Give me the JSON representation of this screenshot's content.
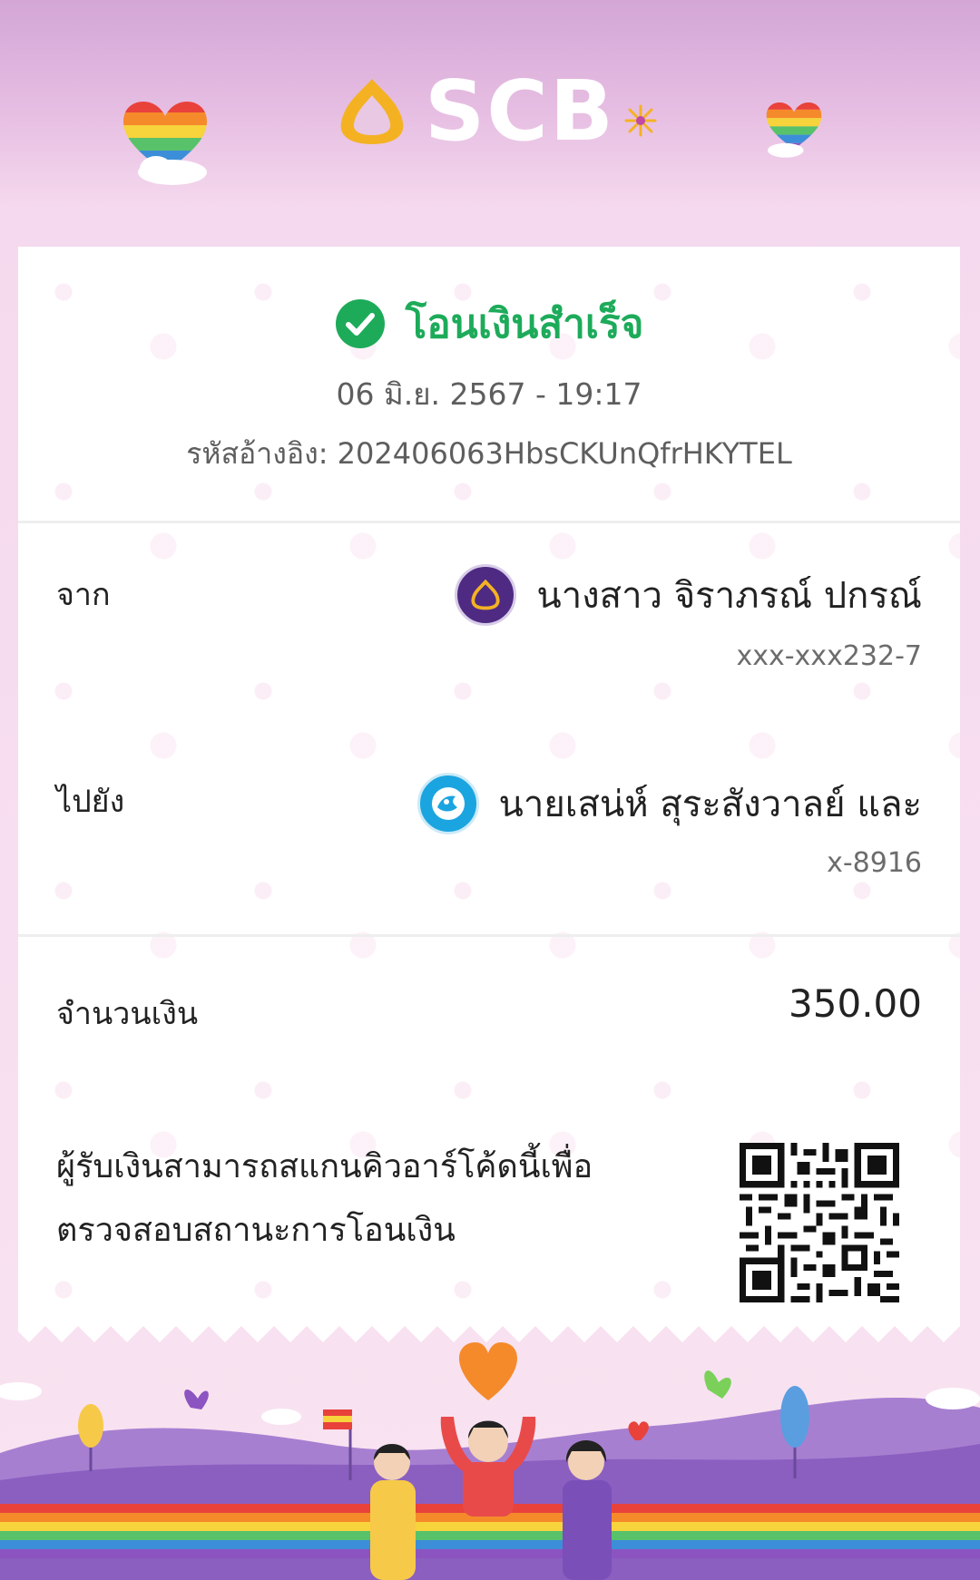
{
  "brand": {
    "name": "SCB",
    "accent": "#f4b223",
    "purple": "#4e2a82"
  },
  "status": {
    "title": "โอนเงินสำเร็จ",
    "color": "#1dab5a"
  },
  "transaction": {
    "datetime": "06 มิ.ย. 2567 - 19:17",
    "reference": "รหัสอ้างอิง: 202406063HbsCKUnQfrHKYTEL"
  },
  "from": {
    "label": "จาก",
    "name": "นางสาว จิราภรณ์ ปกรณ์",
    "account": "xxx-xxx232-7"
  },
  "to": {
    "label": "ไปยัง",
    "name": "นายเสน่ห์ สุระสังวาลย์ และ",
    "account": "x-8916"
  },
  "amount": {
    "label": "จำนวนเงิน",
    "value": "350.00"
  },
  "note": {
    "line1": "ผู้รับเงินสามารถสแกนคิวอาร์โค้ดนี้เพื่อ",
    "line2": "ตรวจสอบสถานะการโอนเงิน"
  }
}
